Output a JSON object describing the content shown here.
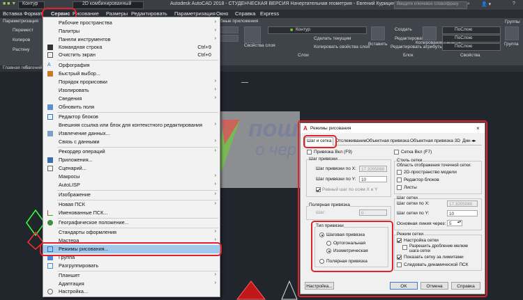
{
  "window": {
    "title": "Autodesk AutoCAD 2018 - СТУДЕНЧЕСКАЯ ВЕРСИЯ    Начертательная геометрия - Евгений Курицин.dwg",
    "search_placeholder": "Введите ключевое слово/фразу",
    "qat_layer": "Контур",
    "workspace": "2D комбинированный"
  },
  "menubar": [
    "Вставка",
    "Формат",
    "Сервис",
    "Рисование",
    "Размеры",
    "Редактировать",
    "Параметризация",
    "Окно",
    "Справка",
    "Express"
  ],
  "ribbon": {
    "left_labels": [
      "Параметризация",
      "Перемест",
      "Копиров",
      "Растяну"
    ],
    "right_tab": "бные приложения",
    "layer_name": "Контур",
    "set_current": "Сделать текущим",
    "copy_layer_props": "Копировать свойства слоя",
    "layer_props": "Свойства слоя",
    "insert": "Вставить",
    "create": "Создать",
    "edit": "Редактировать",
    "edit_attr": "Редактировать атрибуты",
    "copy_props": "Копирование свойств",
    "by_layer_1": "ПоСлою",
    "by_layer_2": "ПоСлою",
    "by_layer_3": "ПоСлою",
    "groups": "Группы",
    "group": "Группа",
    "panel_layers": "Слои",
    "panel_block": "Блок",
    "panel_props": "Свойства"
  },
  "doc_tab": "Евгений Ку...",
  "doc_tab_left": "Главная гео...",
  "tools_menu": {
    "items": [
      {
        "label": "Рабочие пространства",
        "arrow": true
      },
      {
        "label": "Палитры",
        "arrow": true
      },
      {
        "label": "Панели инструментов",
        "arrow": true
      },
      {
        "label": "Командная строка",
        "shortcut": "Ctrl+9"
      },
      {
        "label": "Очистить экран",
        "shortcut": "Ctrl+0"
      },
      {
        "label": "Орфография"
      },
      {
        "label": "Быстрый выбор..."
      },
      {
        "label": "Порядок прорисовки",
        "arrow": true
      },
      {
        "label": "Изолировать",
        "arrow": true
      },
      {
        "label": "Сведения",
        "arrow": true
      },
      {
        "label": "Обновить поля"
      },
      {
        "label": "Редактор блоков"
      },
      {
        "label": "Внешняя ссылка или блок для контекстного редактирования",
        "arrow": true
      },
      {
        "label": "Извлечение данных..."
      },
      {
        "label": "Связь с данными",
        "arrow": true
      },
      {
        "label": "Рекордер операций",
        "arrow": true
      },
      {
        "label": "Приложения..."
      },
      {
        "label": "Сценарий..."
      },
      {
        "label": "Макросы",
        "arrow": true
      },
      {
        "label": "AutoLISP",
        "arrow": true
      },
      {
        "label": "Изображение",
        "arrow": true
      },
      {
        "label": "Новая ПСК",
        "arrow": true
      },
      {
        "label": "Именованные ПСК..."
      },
      {
        "label": "Географическое положение..."
      },
      {
        "label": "Стандарты оформления",
        "arrow": true
      },
      {
        "label": "Мастера",
        "arrow": true
      },
      {
        "label": "Режимы рисования..."
      },
      {
        "label": "Группа"
      },
      {
        "label": "Разгруппировать"
      },
      {
        "label": "Планшет",
        "arrow": true
      },
      {
        "label": "Адаптация",
        "arrow": true
      },
      {
        "label": "Настройка..."
      }
    ]
  },
  "watermark": {
    "line1": "пошли",
    "line2": "о чер"
  },
  "dialog": {
    "title": "Режимы рисования",
    "tabs": [
      "Шаг и сетка",
      "Отслеживание",
      "Объектная привязка",
      "Объектная привязка 3D",
      "Дин"
    ],
    "snap_on": "Привязка Вкл (F9)",
    "grid_on": "Сетка Вкл (F7)",
    "snap_spacing": "Шаг привязки",
    "snap_x_label": "Шаг привязки по X:",
    "snap_x": "17.3205080",
    "snap_y_label": "Шаг привязки по Y:",
    "snap_y": "10",
    "equal_xy": "Равный шаг по осям X и Y",
    "polar_spacing": "Полярная привязка",
    "polar_dist_label": "Шаг:",
    "polar_dist": "0",
    "snap_type": "Тип привязки",
    "grid_snap": "Шаговая привязка",
    "rect_snap": "Ортогональная",
    "iso_snap": "Изометрическая",
    "polar_snap": "Полярная привязка",
    "grid_style": "Стиль сетки",
    "grid_style_sub": "Область отображения точечной сетки:",
    "gs_2d": "2D-пространство модели",
    "gs_block": "Редактор блоков",
    "gs_sheet": "Листы",
    "grid_spacing": "Шаг сетки",
    "grid_x_label": "Шаг сетки по X:",
    "grid_x": "17.3205080",
    "grid_y_label": "Шаг сетки по Y:",
    "grid_y": "10",
    "major_label": "Основная линия через:",
    "major": "5",
    "grid_behavior": "Режим сетки",
    "adaptive": "Настройка сетки",
    "subdiv": "Разрешить дробление мелкие шага сетки",
    "beyond": "Показать сетку за лимитами",
    "follow_ucs": "Следовать динамической ПСК",
    "btn_options": "Настройка...",
    "btn_ok": "OK",
    "btn_cancel": "Отмена",
    "btn_help": "Справка"
  }
}
